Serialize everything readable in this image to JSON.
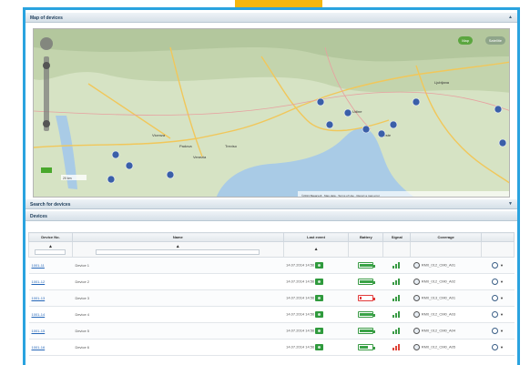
{
  "map_panel": {
    "title": "Map of devices",
    "collapse_icon": "collapse-icon"
  },
  "map": {
    "toggle_left": "Map",
    "toggle_right": "Satellite",
    "place_labels": [
      "Venezia",
      "Padova",
      "Vicenza",
      "Treviso",
      "Trieste",
      "Udine",
      "Ljubljana"
    ],
    "attribution": "©2013 Basarsoft · Map data · Terms of Use · Report a map error",
    "scale": "20 km"
  },
  "search_panel": {
    "title": "Search for devices",
    "collapse_icon": "expand-icon"
  },
  "devices_panel": {
    "title": "Devices"
  },
  "table": {
    "columns": [
      "Device No.",
      "Name",
      "Last event",
      "Battery",
      "Signal",
      "Coverage",
      ""
    ],
    "sort_icon": "▲",
    "rows": [
      {
        "no": "1001-11",
        "name": "Device 1",
        "last_event": "14.07.2014 14:56",
        "battery_level": 0.95,
        "signal": "strong",
        "coverage": "RM0_012_CM0_A01"
      },
      {
        "no": "1001-12",
        "name": "Device 2",
        "last_event": "14.07.2014 14:56",
        "battery_level": 0.95,
        "signal": "strong",
        "coverage": "RM0_012_CM0_A02"
      },
      {
        "no": "1001-13",
        "name": "Device 3",
        "last_event": "14.07.2014 14:56",
        "battery_level": 0.1,
        "signal": "strong",
        "coverage": "RM0_013_CM0_A01"
      },
      {
        "no": "1001-14",
        "name": "Device 4",
        "last_event": "14.07.2014 14:56",
        "battery_level": 0.95,
        "signal": "strong",
        "coverage": "RM0_012_CM0_A03"
      },
      {
        "no": "1001-15",
        "name": "Device 5",
        "last_event": "14.07.2014 14:56",
        "battery_level": 0.95,
        "signal": "strong",
        "coverage": "RM0_012_CM0_A04"
      },
      {
        "no": "1001-16",
        "name": "Device 6",
        "last_event": "14.07.2014 14:56",
        "battery_level": 0.6,
        "signal": "weak",
        "coverage": "RM0_012_CM0_A05"
      }
    ]
  },
  "colors": {
    "frame": "#2aa3df",
    "arrow": "#f4b610",
    "map_pin": "#3a5fa8",
    "ok": "#3aa347",
    "alert": "#e23a3a"
  }
}
